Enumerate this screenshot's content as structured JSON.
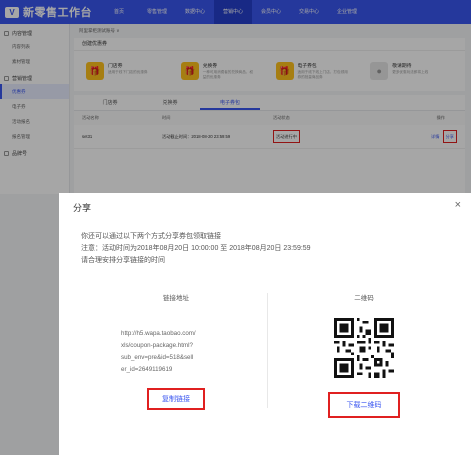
{
  "brand": {
    "logo_glyph": "V",
    "name": "新零售工作台"
  },
  "nav": {
    "items": [
      "首页",
      "零售管理",
      "数据中心",
      "营销中心",
      "会员中心",
      "交易中心",
      "企业管理"
    ],
    "active_index": 3
  },
  "sidebar": {
    "groups": [
      {
        "label": "内容管理",
        "items": [
          "内容列表",
          "素材管理"
        ]
      },
      {
        "label": "营销管理",
        "items": [
          "优惠券",
          "电子券",
          "活动报名",
          "报名管理"
        ]
      },
      {
        "label": "品牌号",
        "items": []
      }
    ],
    "active_item": "优惠券"
  },
  "breadcrumb": "阿里掌柜测试账号 ∨",
  "create_panel": {
    "title": "创建优惠券",
    "cards": [
      {
        "title": "门店券",
        "desc": "适用于线下门店的优惠券",
        "icon": "gift-icon"
      },
      {
        "title": "兑换券",
        "desc": "一种可用消费者的兑换商品，权益的优惠券",
        "icon": "gift-icon"
      },
      {
        "title": "电子券包",
        "desc": "适用于线下线上门店，打包领用券的批量商品券",
        "icon": "gift-icon"
      },
      {
        "title": "敬请期待",
        "desc": "更多优惠玩法即将上线",
        "icon": "circle-icon"
      }
    ]
  },
  "tabs": {
    "items": [
      "门店券",
      "兑换券",
      "电子券包"
    ],
    "active_index": 2
  },
  "table": {
    "headers": [
      "活动名称",
      "时间",
      "活动状态",
      "操作"
    ],
    "rows": [
      {
        "name": "set31",
        "time": "活动截止时间：2018-08-20 23:59:59",
        "status": "活动进行中",
        "op1": "详情",
        "op2": "分享"
      }
    ]
  },
  "modal": {
    "title": "分享",
    "close": "×",
    "line1": "你还可以通过以下两个方式分享券包领取链接",
    "line2": "注意：活动时间为2018年08月20日 10:00:00 至 2018年08月20日 23:59:59",
    "line3": "请合理安排分享链接的时间",
    "link_head": "链接地址",
    "url_lines": [
      "http://h5.wapa.taobao.com/",
      "xls/coupon-package.html?",
      "sub_env=pre&id=518&sell",
      "er_id=2649119619"
    ],
    "copy_label": "复制链接",
    "qr_head": "二维码",
    "download_label": "下载二维码"
  },
  "colors": {
    "primary": "#3a56f0",
    "highlight": "#e02020",
    "accent": "#ffc21c"
  }
}
